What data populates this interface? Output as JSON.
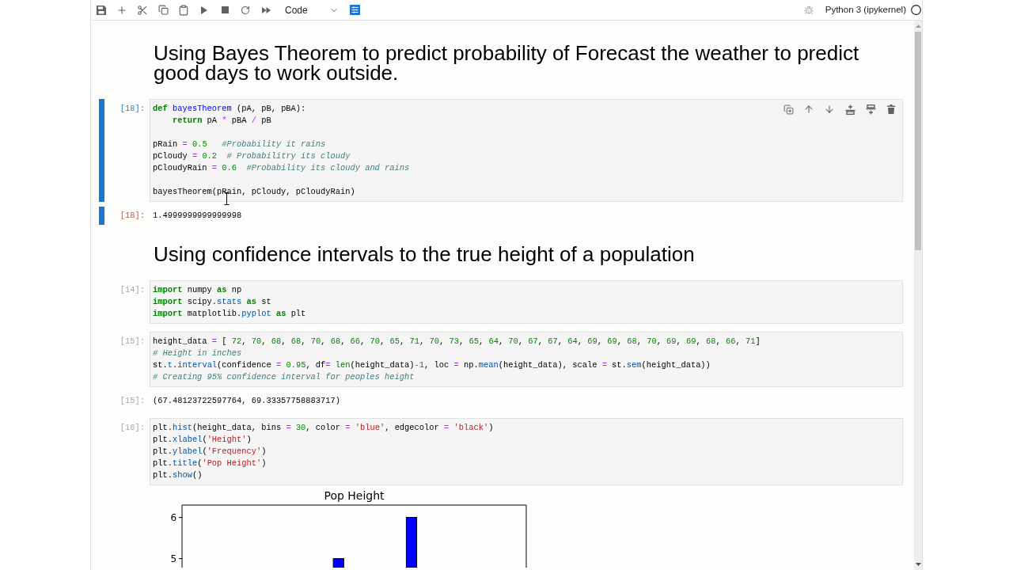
{
  "toolbar": {
    "cell_type": "Code",
    "kernel": "Python 3 (ipykernel)",
    "kernel_busy": false
  },
  "cells": [
    {
      "kind": "markdown",
      "selected": false,
      "heading": "Using Bayes Theorem to predict probability of Forecast the weather to predict good days to work outside."
    },
    {
      "kind": "code",
      "selected": true,
      "prompt": "[18]:",
      "code": [
        {
          "kind": "keyword",
          "text": "def "
        },
        {
          "kind": "def",
          "text": "bayesTheorem"
        },
        {
          "kind": "plain",
          "text": " (pA, pB, pBA):\n    "
        },
        {
          "kind": "keyword",
          "text": "return"
        },
        {
          "kind": "plain",
          "text": " pA "
        },
        {
          "kind": "operator",
          "text": "* "
        },
        {
          "kind": "plain",
          "text": "pBA "
        },
        {
          "kind": "operator",
          "text": "/ "
        },
        {
          "kind": "plain",
          "text": "pB\n\npRain "
        },
        {
          "kind": "operator",
          "text": "= "
        },
        {
          "kind": "number",
          "text": "0.5   "
        },
        {
          "kind": "comment",
          "text": "#Probability it rains"
        },
        {
          "kind": "plain",
          "text": "\npCloudy "
        },
        {
          "kind": "operator",
          "text": "= "
        },
        {
          "kind": "number",
          "text": "0.2  "
        },
        {
          "kind": "comment",
          "text": "# Probabilitry its cloudy"
        },
        {
          "kind": "plain",
          "text": "\npCloudyRain "
        },
        {
          "kind": "operator",
          "text": "= "
        },
        {
          "kind": "number",
          "text": "0.6  "
        },
        {
          "kind": "comment",
          "text": "#Probability its cloudy and rains"
        },
        {
          "kind": "plain",
          "text": "\n\nbayesTheorem(pRain, pCloudy, pCloudyRain)"
        }
      ],
      "output": {
        "kind": "text",
        "prompt": "[18]:",
        "text": "1.4999999999999998"
      }
    },
    {
      "kind": "markdown",
      "selected": false,
      "heading": "Using confidence intervals to the true height of a population"
    },
    {
      "kind": "code",
      "selected": false,
      "prompt": "[14]:",
      "code": [
        {
          "kind": "keyword",
          "text": "import"
        },
        {
          "kind": "plain",
          "text": " numpy "
        },
        {
          "kind": "keyword",
          "text": "as"
        },
        {
          "kind": "plain",
          "text": " np\n"
        },
        {
          "kind": "keyword",
          "text": "import"
        },
        {
          "kind": "plain",
          "text": " scipy."
        },
        {
          "kind": "property",
          "text": "stats "
        },
        {
          "kind": "keyword",
          "text": "as"
        },
        {
          "kind": "plain",
          "text": " st\n"
        },
        {
          "kind": "keyword",
          "text": "import"
        },
        {
          "kind": "plain",
          "text": " matplotlib."
        },
        {
          "kind": "property",
          "text": "pyplot "
        },
        {
          "kind": "keyword",
          "text": "as"
        },
        {
          "kind": "plain",
          "text": " plt"
        }
      ]
    },
    {
      "kind": "code",
      "selected": false,
      "prompt": "[15]:",
      "code": [
        {
          "kind": "plain",
          "text": "height_data "
        },
        {
          "kind": "operator",
          "text": "= "
        },
        {
          "kind": "plain",
          "text": "[ "
        },
        {
          "kind": "number",
          "text": "72"
        },
        {
          "kind": "plain",
          "text": ", "
        },
        {
          "kind": "number",
          "text": "70"
        },
        {
          "kind": "plain",
          "text": ", "
        },
        {
          "kind": "number",
          "text": "68"
        },
        {
          "kind": "plain",
          "text": ", "
        },
        {
          "kind": "number",
          "text": "68"
        },
        {
          "kind": "plain",
          "text": ", "
        },
        {
          "kind": "number",
          "text": "70"
        },
        {
          "kind": "plain",
          "text": ", "
        },
        {
          "kind": "number",
          "text": "68"
        },
        {
          "kind": "plain",
          "text": ", "
        },
        {
          "kind": "number",
          "text": "66"
        },
        {
          "kind": "plain",
          "text": ", "
        },
        {
          "kind": "number",
          "text": "70"
        },
        {
          "kind": "plain",
          "text": ", "
        },
        {
          "kind": "number",
          "text": "65"
        },
        {
          "kind": "plain",
          "text": ", "
        },
        {
          "kind": "number",
          "text": "71"
        },
        {
          "kind": "plain",
          "text": ", "
        },
        {
          "kind": "number",
          "text": "70"
        },
        {
          "kind": "plain",
          "text": ", "
        },
        {
          "kind": "number",
          "text": "73"
        },
        {
          "kind": "plain",
          "text": ", "
        },
        {
          "kind": "number",
          "text": "65"
        },
        {
          "kind": "plain",
          "text": ", "
        },
        {
          "kind": "number",
          "text": "64"
        },
        {
          "kind": "plain",
          "text": ", "
        },
        {
          "kind": "number",
          "text": "70"
        },
        {
          "kind": "plain",
          "text": ", "
        },
        {
          "kind": "number",
          "text": "67"
        },
        {
          "kind": "plain",
          "text": ", "
        },
        {
          "kind": "number",
          "text": "67"
        },
        {
          "kind": "plain",
          "text": ", "
        },
        {
          "kind": "number",
          "text": "64"
        },
        {
          "kind": "plain",
          "text": ", "
        },
        {
          "kind": "number",
          "text": "69"
        },
        {
          "kind": "plain",
          "text": ", "
        },
        {
          "kind": "number",
          "text": "69"
        },
        {
          "kind": "plain",
          "text": ", "
        },
        {
          "kind": "number",
          "text": "68"
        },
        {
          "kind": "plain",
          "text": ", "
        },
        {
          "kind": "number",
          "text": "70"
        },
        {
          "kind": "plain",
          "text": ", "
        },
        {
          "kind": "number",
          "text": "69"
        },
        {
          "kind": "plain",
          "text": ", "
        },
        {
          "kind": "number",
          "text": "69"
        },
        {
          "kind": "plain",
          "text": ", "
        },
        {
          "kind": "number",
          "text": "68"
        },
        {
          "kind": "plain",
          "text": ", "
        },
        {
          "kind": "number",
          "text": "66"
        },
        {
          "kind": "plain",
          "text": ", "
        },
        {
          "kind": "number",
          "text": "71"
        },
        {
          "kind": "plain",
          "text": "]\n"
        },
        {
          "kind": "comment",
          "text": "# Height in inches"
        },
        {
          "kind": "plain",
          "text": "\nst."
        },
        {
          "kind": "property",
          "text": "t"
        },
        {
          "kind": "plain",
          "text": "."
        },
        {
          "kind": "property",
          "text": "interval"
        },
        {
          "kind": "plain",
          "text": "(confidence "
        },
        {
          "kind": "operator",
          "text": "= "
        },
        {
          "kind": "number",
          "text": "0.95"
        },
        {
          "kind": "plain",
          "text": ", df"
        },
        {
          "kind": "operator",
          "text": "= "
        },
        {
          "kind": "builtin",
          "text": "len"
        },
        {
          "kind": "plain",
          "text": "(height_data)"
        },
        {
          "kind": "operator",
          "text": "-"
        },
        {
          "kind": "number",
          "text": "1"
        },
        {
          "kind": "plain",
          "text": ", loc "
        },
        {
          "kind": "operator",
          "text": "= "
        },
        {
          "kind": "plain",
          "text": "np."
        },
        {
          "kind": "property",
          "text": "mean"
        },
        {
          "kind": "plain",
          "text": "(height_data), scale "
        },
        {
          "kind": "operator",
          "text": "= "
        },
        {
          "kind": "plain",
          "text": "st."
        },
        {
          "kind": "property",
          "text": "sem"
        },
        {
          "kind": "plain",
          "text": "(height_data))\n"
        },
        {
          "kind": "comment",
          "text": "# Creating 95% confidence interval for peoples height"
        }
      ],
      "output": {
        "kind": "text",
        "prompt": "[15]:",
        "text": "(67.48123722597764, 69.33357758883717)"
      }
    },
    {
      "kind": "code",
      "selected": false,
      "prompt": "[16]:",
      "code": [
        {
          "kind": "plain",
          "text": "plt."
        },
        {
          "kind": "property",
          "text": "hist"
        },
        {
          "kind": "plain",
          "text": "(height_data, bins "
        },
        {
          "kind": "operator",
          "text": "= "
        },
        {
          "kind": "number",
          "text": "30"
        },
        {
          "kind": "plain",
          "text": ", color "
        },
        {
          "kind": "operator",
          "text": "= "
        },
        {
          "kind": "string",
          "text": "'blue'"
        },
        {
          "kind": "plain",
          "text": ", edgecolor "
        },
        {
          "kind": "operator",
          "text": "= "
        },
        {
          "kind": "string",
          "text": "'black'"
        },
        {
          "kind": "plain",
          "text": ")\nplt."
        },
        {
          "kind": "property",
          "text": "xlabel"
        },
        {
          "kind": "plain",
          "text": "("
        },
        {
          "kind": "string",
          "text": "'Height'"
        },
        {
          "kind": "plain",
          "text": ")\nplt."
        },
        {
          "kind": "property",
          "text": "ylabel"
        },
        {
          "kind": "plain",
          "text": "("
        },
        {
          "kind": "string",
          "text": "'Frequency'"
        },
        {
          "kind": "plain",
          "text": ")\nplt."
        },
        {
          "kind": "property",
          "text": "title"
        },
        {
          "kind": "plain",
          "text": "("
        },
        {
          "kind": "string",
          "text": "'Pop Height'"
        },
        {
          "kind": "plain",
          "text": ")\nplt."
        },
        {
          "kind": "property",
          "text": "show"
        },
        {
          "kind": "plain",
          "text": "()"
        }
      ],
      "output": {
        "kind": "chart",
        "chart_data": {
          "type": "bar",
          "title": "Pop Height",
          "categories": [
            null,
            null,
            null,
            null,
            null,
            null,
            null,
            null,
            null,
            null,
            null,
            null,
            null,
            null,
            null,
            null,
            null,
            null,
            null,
            null,
            null,
            null,
            null,
            null,
            null,
            null,
            null,
            null,
            null,
            null
          ],
          "values": [
            null,
            null,
            null,
            null,
            null,
            null,
            null,
            null,
            null,
            null,
            null,
            null,
            null,
            5,
            null,
            null,
            null,
            null,
            null,
            null,
            6,
            null,
            null,
            null,
            null,
            null,
            null,
            null,
            null,
            null
          ],
          "color": "#0000ff",
          "ylim": [
            4.78,
            6.3
          ],
          "yticks": [
            5,
            6
          ]
        }
      }
    }
  ]
}
